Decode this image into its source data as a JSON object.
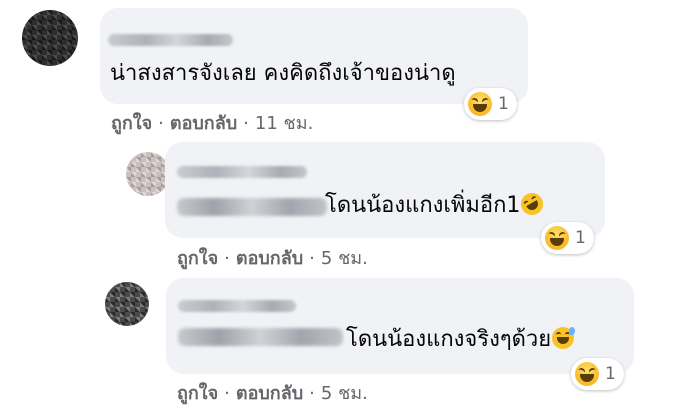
{
  "comments": [
    {
      "text": "น่าสงสารจังเลย คงคิดถึงเจ้าของน่าดู",
      "reaction_count": "1",
      "reaction_icon": "haha-icon",
      "like_label": "ถูกใจ",
      "reply_label": "ตอบกลับ",
      "separator": "·",
      "time": "11 ชม."
    },
    {
      "text": "โดนน้องแกงเพิ่มอีก1",
      "trailing_emoji": "rolling-laughing-icon",
      "reaction_count": "1",
      "reaction_icon": "haha-icon",
      "like_label": "ถูกใจ",
      "reply_label": "ตอบกลับ",
      "separator": "·",
      "time": "5 ชม."
    },
    {
      "text": "โดนน้องแกงจริงๆด้วย",
      "trailing_emoji": "grinning-sweat-icon",
      "reaction_count": "1",
      "reaction_icon": "haha-icon",
      "like_label": "ถูกใจ",
      "reply_label": "ตอบกลับ",
      "separator": "·",
      "time": "5 ชม."
    }
  ]
}
